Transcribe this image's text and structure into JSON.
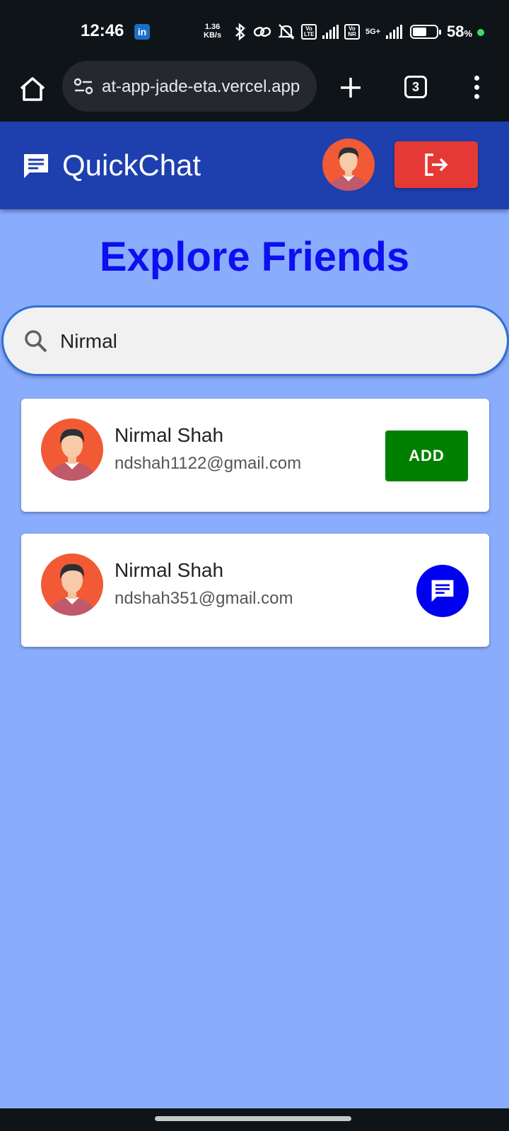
{
  "status_bar": {
    "time": "12:46",
    "notification_badge": "in",
    "net_speed_value": "1.36",
    "net_speed_unit": "KB/s",
    "volte1": "Vo LTE",
    "volte2": "Vo NR",
    "network": "5G+",
    "battery_percent": "58",
    "battery_percent_sign": "%",
    "battery_level": 0.58
  },
  "browser": {
    "url": "at-app-jade-eta.vercel.app",
    "tab_count": "3"
  },
  "header": {
    "title": "QuickChat"
  },
  "page": {
    "title": "Explore Friends"
  },
  "search": {
    "value": "Nirmal"
  },
  "results": [
    {
      "name": "Nirmal Shah",
      "email": "ndshah1122@gmail.com",
      "action": "add",
      "action_label": "ADD"
    },
    {
      "name": "Nirmal Shah",
      "email": "ndshah351@gmail.com",
      "action": "chat"
    }
  ],
  "colors": {
    "background": "#8aacfc",
    "header": "#1e3fae",
    "title": "#0d0ff0",
    "add_button": "#008000",
    "chat_button": "#0000f0",
    "logout_button": "#e53935"
  }
}
